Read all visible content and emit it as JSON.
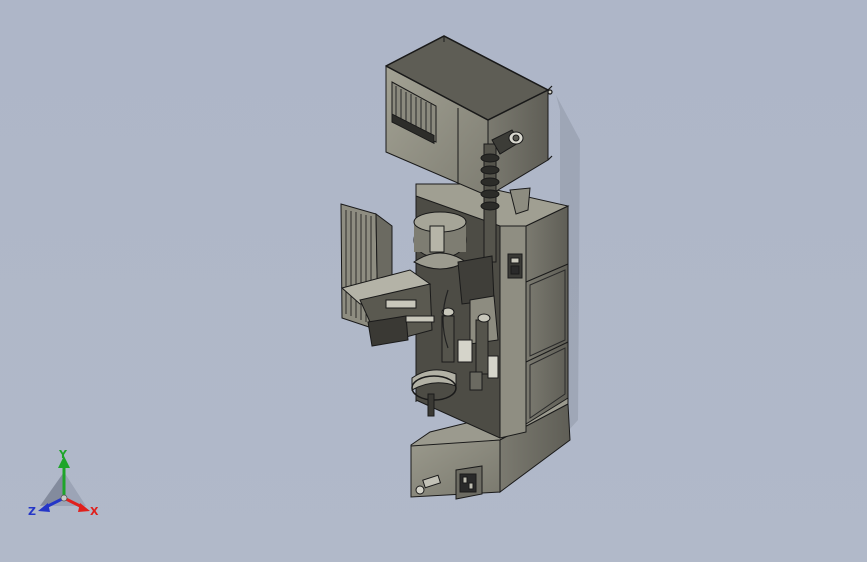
{
  "view": {
    "background_top": "#aeb6c8",
    "background_bottom": "#b1b9c9",
    "model_body_color": "#86857a",
    "model_panel_color": "#6f6e64",
    "model_edge_color": "#1a1a1a"
  },
  "triad": {
    "x_label": "X",
    "y_label": "Y",
    "z_label": "Z",
    "x_color": "#e0201c",
    "y_color": "#1fa52a",
    "z_color": "#2436c8"
  }
}
